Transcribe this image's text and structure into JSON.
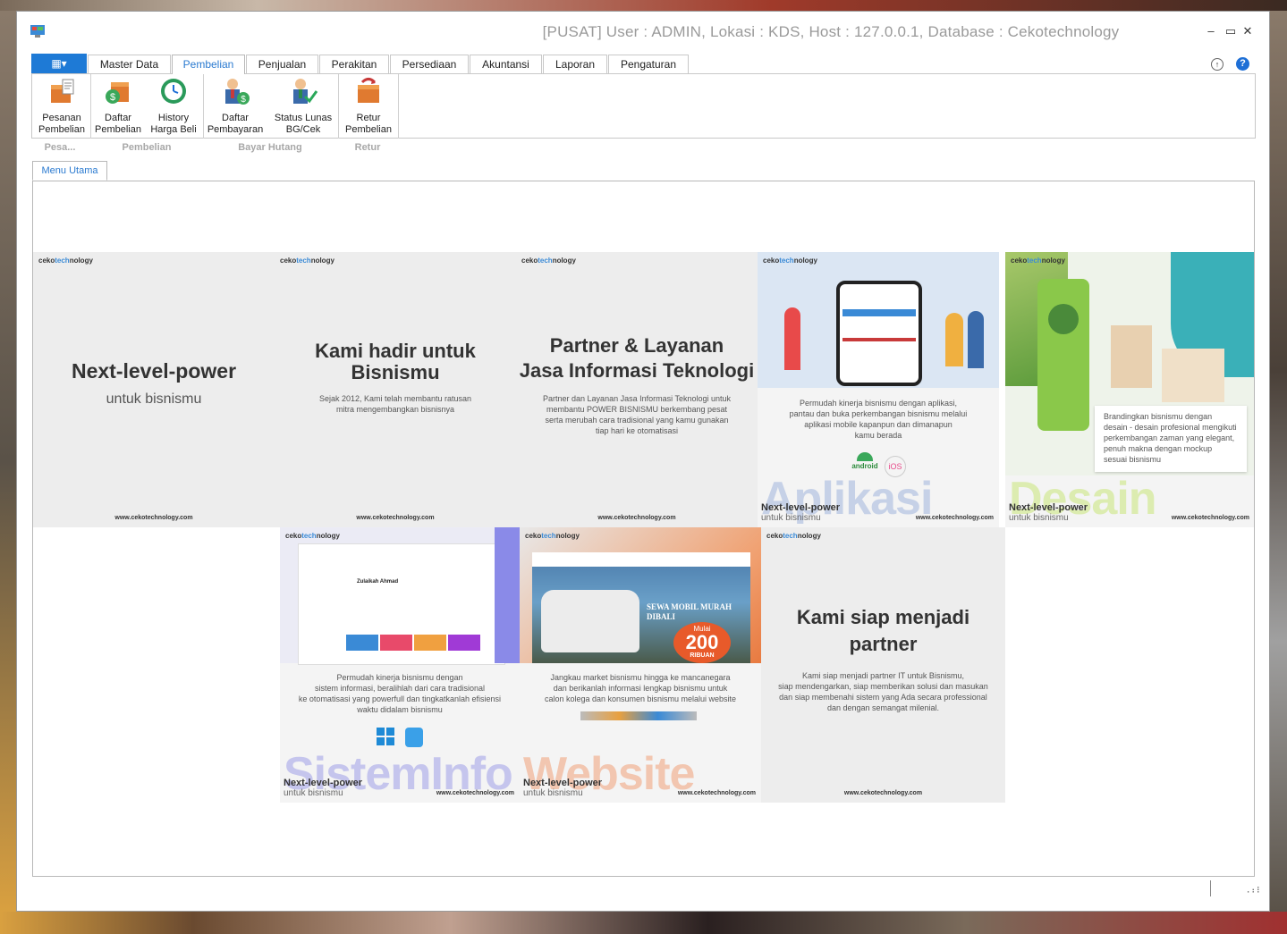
{
  "window": {
    "title": "[PUSAT] User : ADMIN, Lokasi : KDS, Host : 127.0.0.1, Database : Cekotechnology",
    "minimize": "–",
    "maximize": "▭",
    "close": "✕"
  },
  "ribbon": {
    "file_button": "▦▾",
    "tabs": [
      "Master Data",
      "Pembelian",
      "Penjualan",
      "Perakitan",
      "Persediaan",
      "Akuntansi",
      "Laporan",
      "Pengaturan"
    ],
    "active_tab": "Pembelian",
    "buttons": [
      {
        "line1": "Pesanan",
        "line2": "Pembelian",
        "icon": "order-box-icon"
      },
      {
        "line1": "Daftar",
        "line2": "Pembelian",
        "icon": "purchase-list-icon"
      },
      {
        "line1": "History",
        "line2": "Harga Beli",
        "icon": "history-clock-icon"
      },
      {
        "line1": "Daftar",
        "line2": "Pembayaran",
        "icon": "payment-person-icon"
      },
      {
        "line1": "Status Lunas",
        "line2": "BG/Cek",
        "icon": "status-check-person-icon"
      },
      {
        "line1": "Retur",
        "line2": "Pembelian",
        "icon": "return-box-icon"
      }
    ],
    "groups": [
      "Pesa...",
      "Pembelian",
      "Bayar Hutang",
      "Retur"
    ],
    "collapse": "↑",
    "help": "?"
  },
  "document_tab": "Menu Utama",
  "tiles": [
    {
      "brand_a": "ceko",
      "brand_b": "tech",
      "brand_c": "nology",
      "headline": "Next-level-power",
      "sub": "untuk bisnismu",
      "url": "www.cekotechnology.com"
    },
    {
      "brand_a": "ceko",
      "brand_b": "tech",
      "brand_c": "nology",
      "headline1": "Kami hadir untuk",
      "headline2": "Bisnismu",
      "desc1": "Sejak 2012, Kami telah membantu ratusan",
      "desc2": "mitra mengembangkan bisnisnya",
      "url": "www.cekotechnology.com"
    },
    {
      "brand_a": "ceko",
      "brand_b": "tech",
      "brand_c": "nology",
      "headline1": "Partner & Layanan",
      "headline2": "Jasa Informasi Teknologi",
      "desc1": "Partner dan Layanan Jasa Informasi Teknologi untuk",
      "desc2": "membantu POWER BISNISMU berkembang pesat",
      "desc3": "serta merubah cara tradisional yang kamu gunakan",
      "desc4": "tiap hari ke otomatisasi",
      "url": "www.cekotechnology.com"
    },
    {
      "brand_a": "ceko",
      "brand_b": "tech",
      "brand_c": "nology",
      "desc1": "Permudah kinerja bisnismu dengan aplikasi,",
      "desc2": "pantau dan buka perkembangan bisnismu melalui",
      "desc3": "aplikasi mobile kapanpun dan dimanapun",
      "desc4": "kamu berada",
      "android": "android",
      "ios": "iOS",
      "bigword": "Aplikasi",
      "nlp": "Next-level-power",
      "ub": "untuk bisnismu",
      "url": "www.cekotechnology.com"
    },
    {
      "brand_a": "ceko",
      "brand_b": "tech",
      "brand_c": "nology",
      "desc1": "Brandingkan bisnismu dengan",
      "desc2": "desain - desain profesional mengikuti",
      "desc3": "perkembangan zaman yang elegant,",
      "desc4": "penuh makna dengan mockup",
      "desc5": "sesuai bisnismu",
      "bigword": "Desain",
      "nlp": "Next-level-power",
      "ub": "untuk bisnismu",
      "url": "www.cekotechnology.com"
    },
    {
      "brand_a": "ceko",
      "brand_b": "tech",
      "brand_c": "nology",
      "mock_user": "Zulaikah Ahmad",
      "desc1": "Permudah kinerja bisnismu dengan",
      "desc2": "sistem informasi, beralihlah dari cara tradisional",
      "desc3": "ke otomatisasi yang powerfull dan tingkatkanlah efisiensi",
      "desc4": "waktu didalam bisnismu",
      "bigword": "SistemInfo",
      "nlp": "Next-level-power",
      "ub": "untuk bisnismu",
      "url": "www.cekotechnology.com"
    },
    {
      "brand_a": "ceko",
      "brand_b": "tech",
      "brand_c": "nology",
      "promo1": "SEWA MOBIL MURAH",
      "promo2": "DIBALI",
      "promo3": "Mulai",
      "promo4": "200",
      "promo5": "RIBUAN",
      "desc1": "Jangkau market bisnismu hingga ke mancanegara",
      "desc2": "dan berikanlah informasi lengkap bisnismu untuk",
      "desc3": "calon kolega dan konsumen bisnismu melalui website",
      "bigword": "Website",
      "nlp": "Next-level-power",
      "ub": "untuk bisnismu",
      "url": "www.cekotechnology.com"
    },
    {
      "brand_a": "ceko",
      "brand_b": "tech",
      "brand_c": "nology",
      "headline1": "Kami siap menjadi",
      "headline2": "partner",
      "desc1": "Kami siap menjadi partner IT untuk Bisnismu,",
      "desc2": "siap mendengarkan, siap memberikan solusi dan masukan",
      "desc3": "dan siap membenahi sistem yang Ada secara professional",
      "desc4": "dan dengan semangat milenial.",
      "url": "www.cekotechnology.com"
    }
  ],
  "colors": {
    "accent": "#1e7ad6",
    "tile_bg": "#ededed",
    "tab_active": "#2a7ad0"
  }
}
